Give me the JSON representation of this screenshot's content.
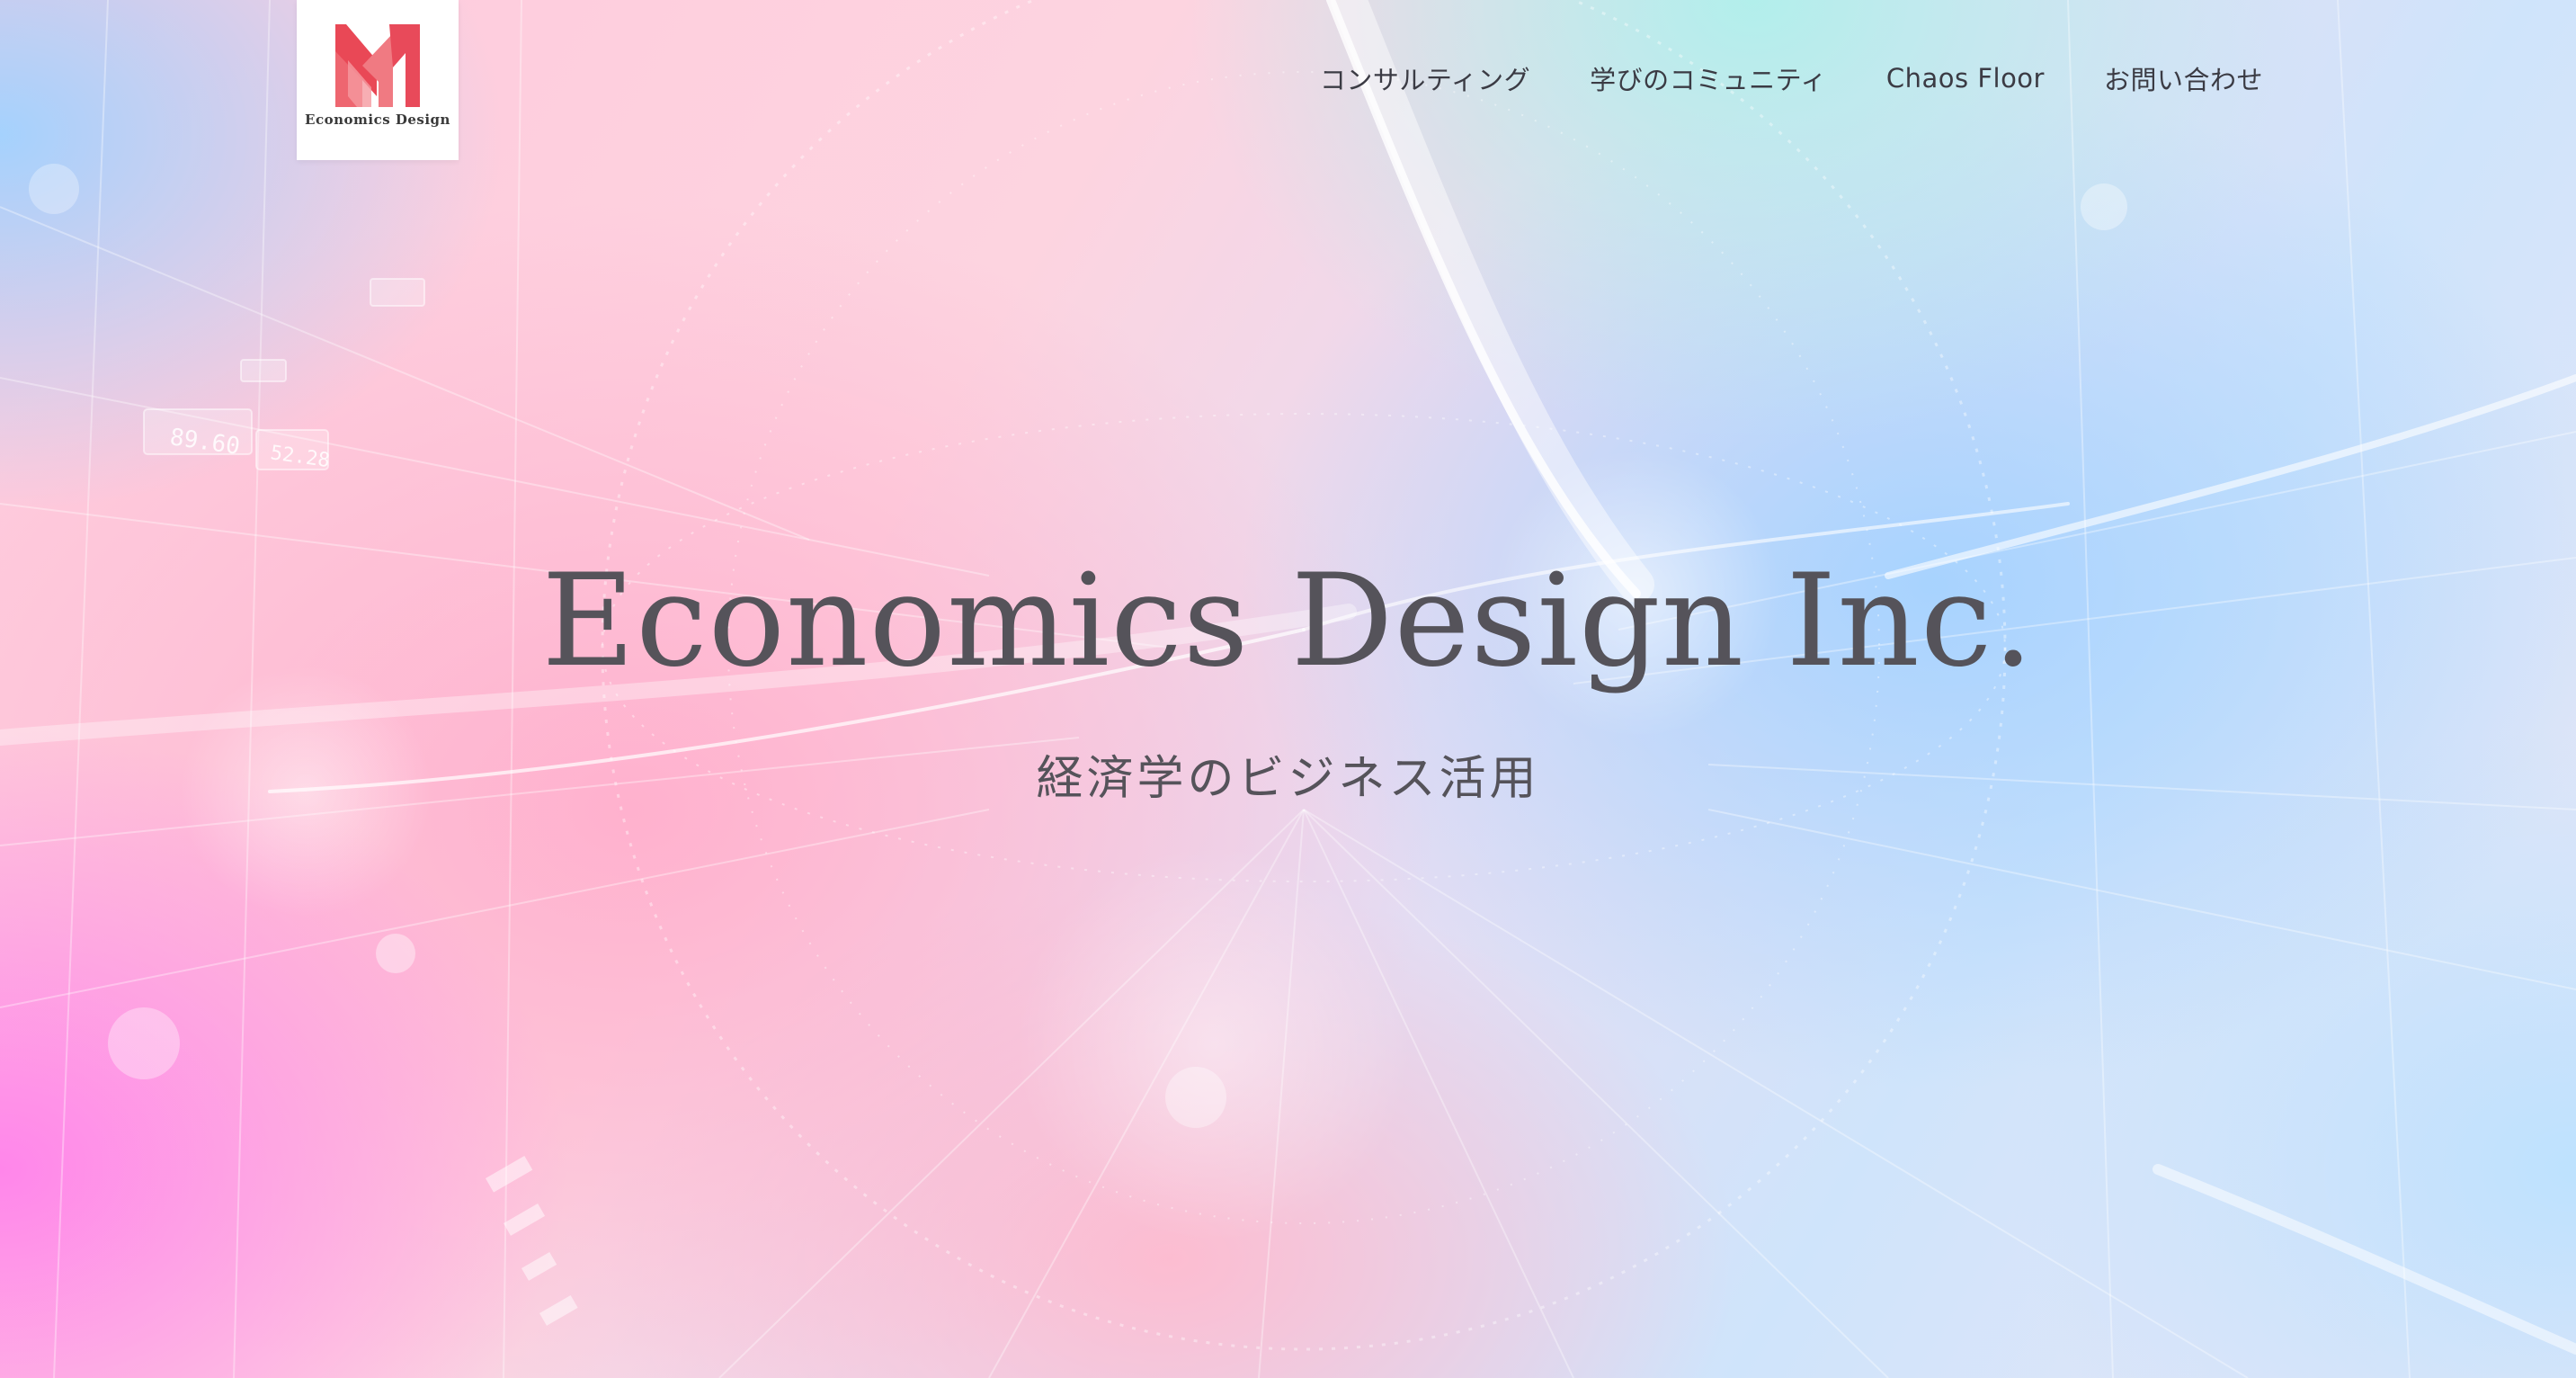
{
  "header": {
    "logo": {
      "icon": "economics-design-logo-mark",
      "text": "Economics Design"
    },
    "nav": {
      "items": [
        {
          "label": "コンサルティング"
        },
        {
          "label": "学びのコミュニティ"
        },
        {
          "label": "Chaos Floor"
        },
        {
          "label": "お問い合わせ"
        }
      ]
    }
  },
  "hero": {
    "title": "Economics Design Inc.",
    "subtitle": "経済学のビジネス活用",
    "overlay_numbers": [
      "89.60",
      "52.28"
    ]
  },
  "colors": {
    "logo_red": "#e84a5a",
    "text": "#55535a",
    "nav_text": "#3b3b44"
  }
}
